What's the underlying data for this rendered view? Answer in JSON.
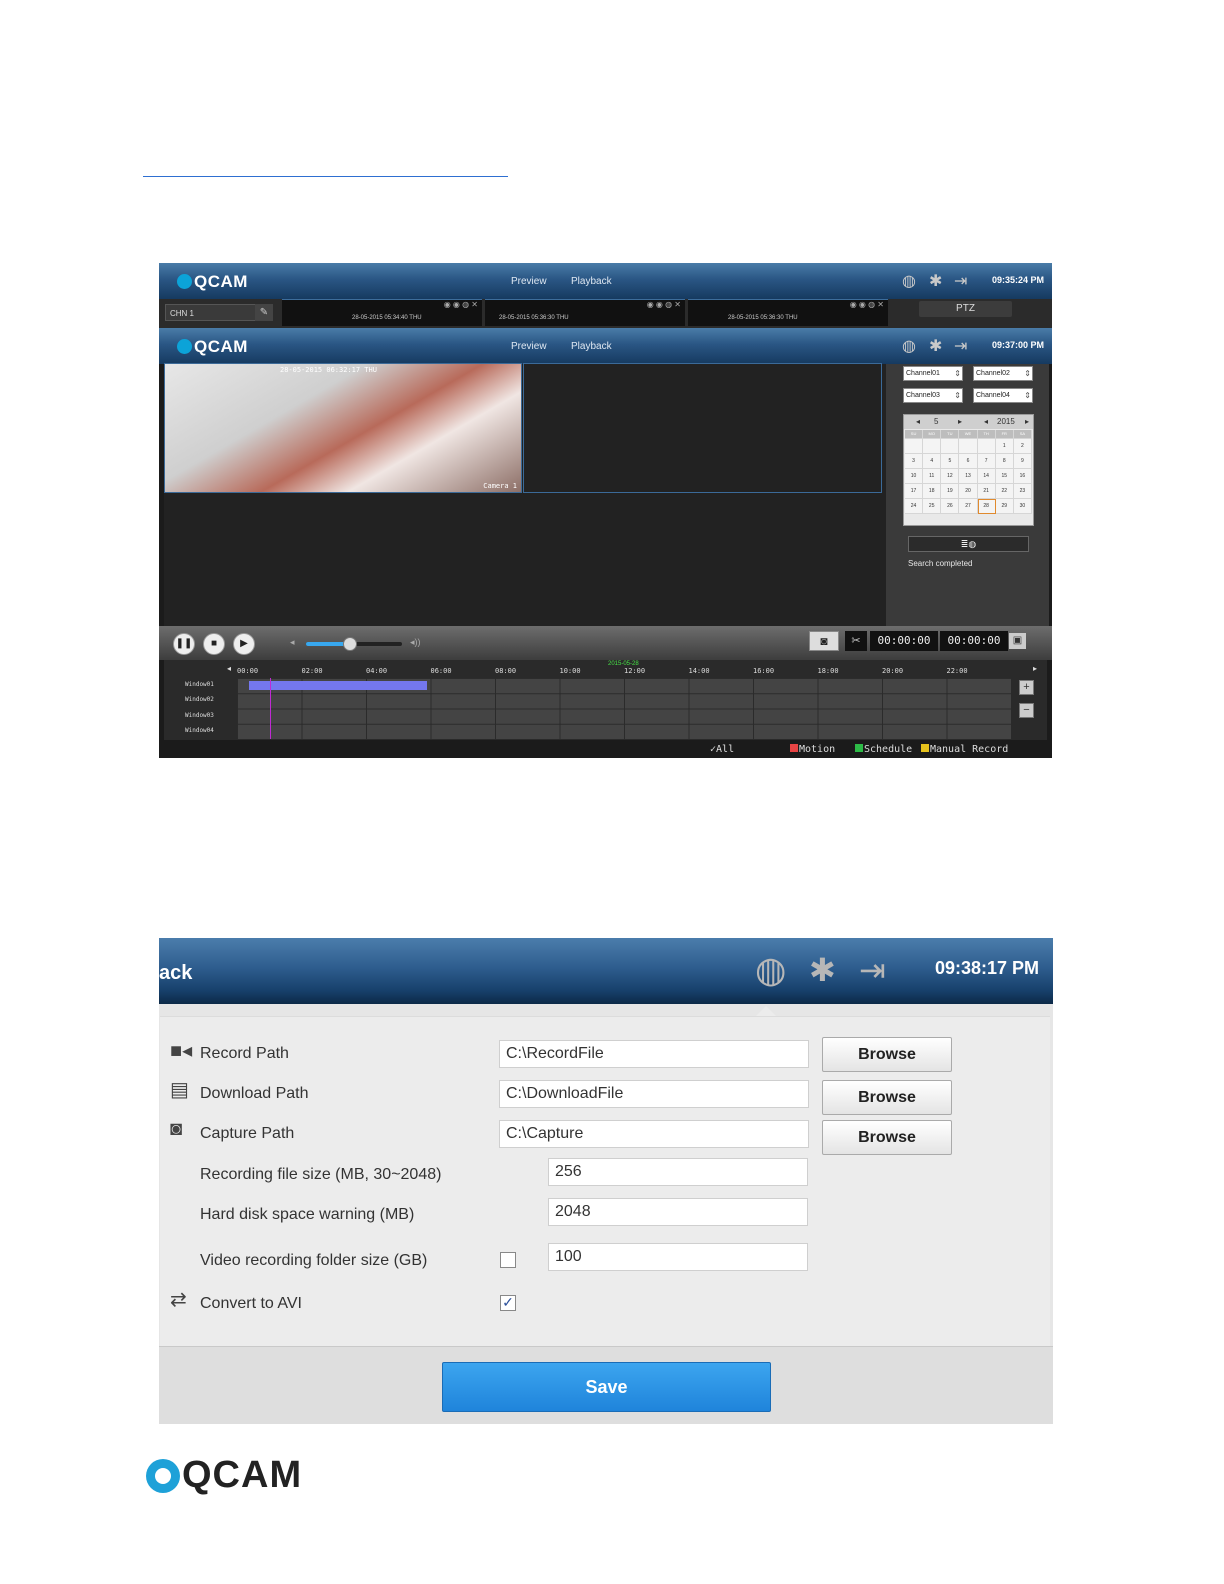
{
  "screenshot1": {
    "app": {
      "logo": "QCAM",
      "nav_preview": "Preview",
      "nav_playback": "Playback",
      "clock_back": "09:35:24 PM",
      "clock_front": "09:37:00 PM",
      "channel_label": "CHN 1",
      "ptz_label": "PTZ"
    },
    "thumbnails": [
      "28-05-2015 05:34:40 THU",
      "28-05-2015 05:36:30 THU",
      "28-05-2015 05:36:30 THU"
    ],
    "video": {
      "timestamp": "28-05-2015 06:32:17 THU",
      "camera_label": "Camera 1"
    },
    "channels": [
      "Channel01",
      "Channel02",
      "Channel03",
      "Channel04"
    ],
    "calendar": {
      "month": "5",
      "year": "2015",
      "weekdays": [
        "SU",
        "MO",
        "TU",
        "WE",
        "TH",
        "FR",
        "SA"
      ],
      "days": [
        "",
        "",
        "",
        "",
        "",
        "1",
        "2",
        "3",
        "4",
        "5",
        "6",
        "7",
        "8",
        "9",
        "10",
        "11",
        "12",
        "13",
        "14",
        "15",
        "16",
        "17",
        "18",
        "19",
        "20",
        "21",
        "22",
        "23",
        "24",
        "25",
        "26",
        "27",
        "28",
        "29",
        "30"
      ],
      "selected_day": "28"
    },
    "search_status": "Search completed",
    "playback": {
      "time_current": "00:00:00",
      "time_total": "00:00:00",
      "volume": 0.45
    },
    "timeline": {
      "date": "2015-05-28",
      "hours": [
        "00:00",
        "02:00",
        "04:00",
        "06:00",
        "08:00",
        "10:00",
        "12:00",
        "14:00",
        "16:00",
        "18:00",
        "20:00",
        "22:00"
      ],
      "rows": [
        "Window01",
        "Window02",
        "Window03",
        "Window04"
      ]
    },
    "legend": {
      "all": "All",
      "motion": "Motion",
      "schedule": "Schedule",
      "manual": "Manual Record",
      "colors": {
        "motion": "#e84444",
        "schedule": "#2dbb47",
        "manual": "#e6c21c"
      }
    }
  },
  "screenshot2": {
    "header": {
      "title_fragment": "ack",
      "clock": "09:38:17 PM"
    },
    "rows": {
      "record_path": {
        "label": "Record Path",
        "value": "C:\\RecordFile",
        "button": "Browse"
      },
      "download_path": {
        "label": "Download Path",
        "value": "C:\\DownloadFile",
        "button": "Browse"
      },
      "capture_path": {
        "label": "Capture Path",
        "value": "C:\\Capture",
        "button": "Browse"
      },
      "file_size": {
        "label": "Recording file size (MB, 30~2048)",
        "value": "256"
      },
      "disk_warning": {
        "label": "Hard disk space warning (MB)",
        "value": "2048"
      },
      "folder_size": {
        "label": "Video recording folder size (GB)",
        "value": "100",
        "checked": false
      },
      "convert_avi": {
        "label": "Convert to AVI",
        "checked": true
      }
    },
    "save_label": "Save"
  },
  "footer_logo": "QCAM"
}
